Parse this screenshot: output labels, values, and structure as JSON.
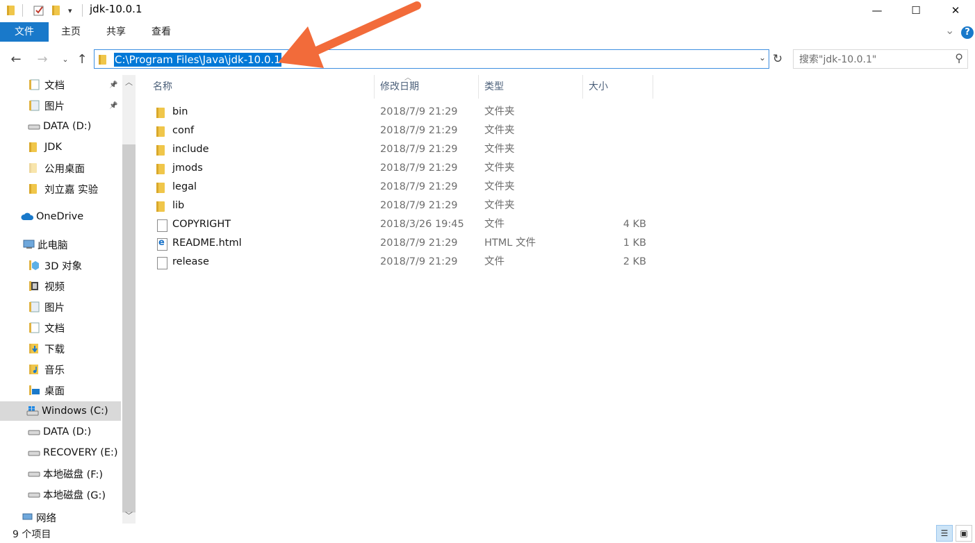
{
  "window": {
    "title": "jdk-10.0.1",
    "minimize": "—",
    "maximize": "☐",
    "close": "✕"
  },
  "ribbon": {
    "tabs": [
      "文件",
      "主页",
      "共享",
      "查看"
    ],
    "expand": "⌄",
    "help": "?"
  },
  "address": {
    "path": "C:\\Program Files\\Java\\jdk-10.0.1",
    "search_placeholder": "搜索\"jdk-10.0.1\""
  },
  "sidebar": {
    "items": [
      {
        "label": "文档",
        "icon": "documents-icon",
        "pinned": true
      },
      {
        "label": "图片",
        "icon": "pictures-icon",
        "pinned": true
      },
      {
        "label": "DATA (D:)",
        "icon": "drive-icon"
      },
      {
        "label": "JDK",
        "icon": "folder-icon"
      },
      {
        "label": "公用桌面",
        "icon": "folder-light-icon"
      },
      {
        "label": "刘立嘉 实验",
        "icon": "folder-icon"
      },
      {
        "label": "OneDrive",
        "icon": "cloud-icon"
      },
      {
        "label": "此电脑",
        "icon": "computer-icon"
      },
      {
        "label": "3D 对象",
        "icon": "3d-objects-icon"
      },
      {
        "label": "视频",
        "icon": "videos-icon"
      },
      {
        "label": "图片",
        "icon": "pictures-icon"
      },
      {
        "label": "文档",
        "icon": "documents-icon"
      },
      {
        "label": "下载",
        "icon": "downloads-icon"
      },
      {
        "label": "音乐",
        "icon": "music-icon"
      },
      {
        "label": "桌面",
        "icon": "desktop-icon"
      },
      {
        "label": "Windows (C:)",
        "icon": "windows-drive-icon",
        "selected": true
      },
      {
        "label": "DATA (D:)",
        "icon": "drive-icon"
      },
      {
        "label": "RECOVERY (E:)",
        "icon": "drive-icon"
      },
      {
        "label": "本地磁盘 (F:)",
        "icon": "drive-icon"
      },
      {
        "label": "本地磁盘 (G:)",
        "icon": "drive-icon"
      },
      {
        "label": "网络",
        "icon": "network-icon"
      }
    ]
  },
  "columns": {
    "name": "名称",
    "date": "修改日期",
    "type": "类型",
    "size": "大小"
  },
  "files": [
    {
      "name": "bin",
      "date": "2018/7/9 21:29",
      "type": "文件夹",
      "size": "",
      "kind": "folder"
    },
    {
      "name": "conf",
      "date": "2018/7/9 21:29",
      "type": "文件夹",
      "size": "",
      "kind": "folder"
    },
    {
      "name": "include",
      "date": "2018/7/9 21:29",
      "type": "文件夹",
      "size": "",
      "kind": "folder"
    },
    {
      "name": "jmods",
      "date": "2018/7/9 21:29",
      "type": "文件夹",
      "size": "",
      "kind": "folder"
    },
    {
      "name": "legal",
      "date": "2018/7/9 21:29",
      "type": "文件夹",
      "size": "",
      "kind": "folder"
    },
    {
      "name": "lib",
      "date": "2018/7/9 21:29",
      "type": "文件夹",
      "size": "",
      "kind": "folder"
    },
    {
      "name": "COPYRIGHT",
      "date": "2018/3/26 19:45",
      "type": "文件",
      "size": "4 KB",
      "kind": "file"
    },
    {
      "name": "README.html",
      "date": "2018/7/9 21:29",
      "type": "HTML 文件",
      "size": "1 KB",
      "kind": "html"
    },
    {
      "name": "release",
      "date": "2018/7/9 21:29",
      "type": "文件",
      "size": "2 KB",
      "kind": "file"
    }
  ],
  "status": {
    "item_count": "9 个项目"
  },
  "colors": {
    "accent": "#1979ca",
    "selection": "#0078d7",
    "annotation_arrow": "#f26b3a"
  }
}
